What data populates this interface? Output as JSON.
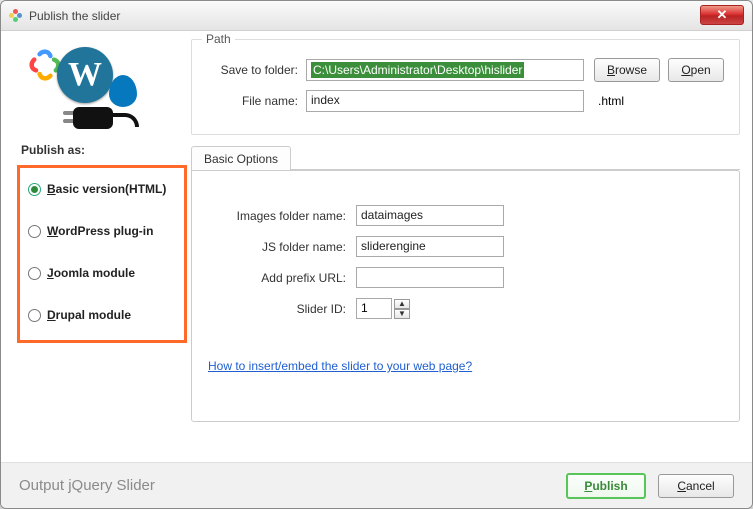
{
  "window": {
    "title": "Publish the slider"
  },
  "left": {
    "publish_as": "Publish as:",
    "options": {
      "basic_prefix": "B",
      "basic_rest": "asic version(HTML)",
      "wp_prefix": "W",
      "wp_rest": "ordPress plug-in",
      "joomla_prefix": "J",
      "joomla_rest": "oomla module",
      "drupal_prefix": "D",
      "drupal_rest": "rupal module"
    }
  },
  "path_group": {
    "legend": "Path",
    "save_label": "Save to folder:",
    "save_value": "C:\\Users\\Administrator\\Desktop\\hislider",
    "browse": "Browse",
    "open": "Open",
    "file_label": "File name:",
    "file_value": "index",
    "ext": ".html"
  },
  "tab": {
    "basic_options": "Basic Options",
    "images_folder_label": "Images folder name:",
    "images_folder_value": "dataimages",
    "js_folder_label": "JS folder name:",
    "js_folder_value": "sliderengine",
    "prefix_label": "Add prefix URL:",
    "prefix_value": "",
    "slider_id_label": "Slider ID:",
    "slider_id_value": "1",
    "help_link": "How to insert/embed the slider to your web page?"
  },
  "footer": {
    "message": "Output jQuery Slider",
    "publish": "Publish",
    "cancel": "Cancel"
  }
}
